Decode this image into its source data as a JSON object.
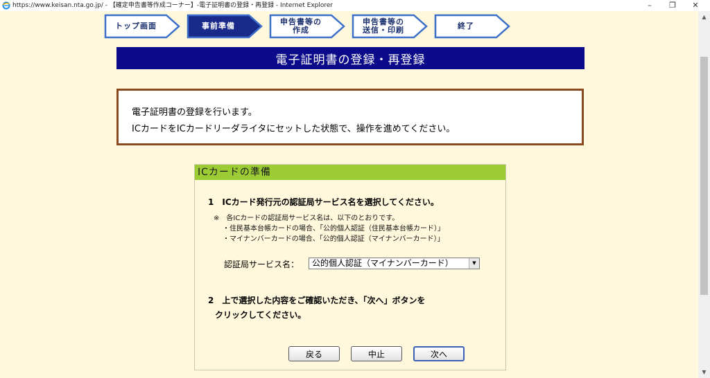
{
  "window": {
    "title": "https://www.keisan.nta.go.jp/ - 【確定申告書等作成コーナー】-電子証明書の登録・再登録 - Internet Explorer",
    "minimize": "–",
    "maximize": "❐",
    "close": "✕"
  },
  "steps": [
    {
      "label": "トップ画面",
      "active": false
    },
    {
      "label": "事前準備",
      "active": true
    },
    {
      "label": "申告書等の\n作成",
      "active": false
    },
    {
      "label": "申告書等の\n送信・印刷",
      "active": false
    },
    {
      "label": "終了",
      "active": false
    }
  ],
  "banner": {
    "title": "電子証明書の登録・再登録"
  },
  "info": {
    "line1": "電子証明書の登録を行います。",
    "line2": "ICカードをICカードリーダライタにセットした状態で、操作を進めてください。"
  },
  "panel": {
    "heading": "ICカードの準備",
    "q1": "1　ICカード発行元の認証局サービス名を選択してください。",
    "note1": "※　各ICカードの認証局サービス名は、以下のとおりです。",
    "note2": "・住民基本台帳カードの場合、「公的個人認証（住民基本台帳カード）」",
    "note3": "・マイナンバーカードの場合、「公的個人認証（マイナンバーカード）」",
    "select_label": "認証局サービス名：",
    "select_value": "公的個人認証（マイナンバーカード）",
    "q2_line1": "2　上で選択した内容をご確認いただき、「次へ」ボタンを",
    "q2_line2": "クリックしてください。"
  },
  "buttons": {
    "back": "戻る",
    "stop": "中止",
    "next": "次へ"
  },
  "colors": {
    "banner": "#0b0a8a",
    "panel_head": "#9ccc35",
    "infobox_border": "#8b4a1e",
    "step_active": "#1a2a8a",
    "page_bg": "#fff8dc"
  }
}
